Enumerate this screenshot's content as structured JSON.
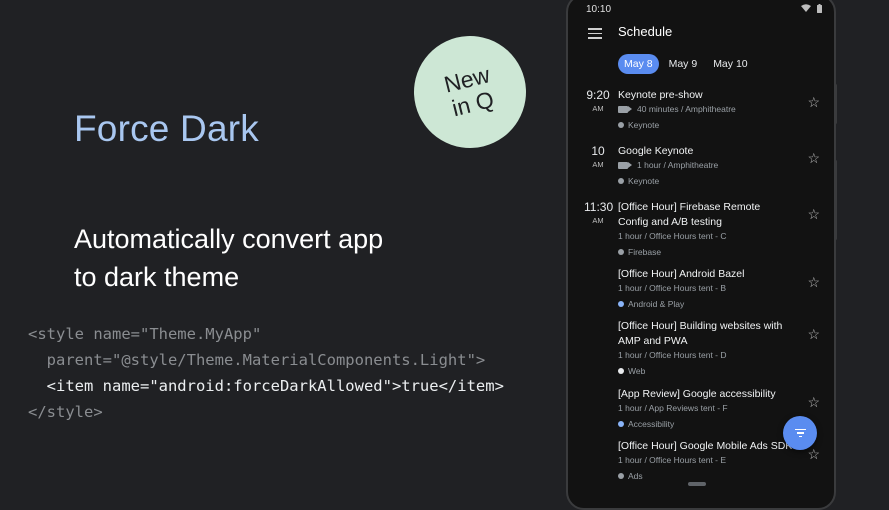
{
  "slide": {
    "title": "Force Dark",
    "subtitle_line1": "Automatically convert app",
    "subtitle_line2": "to dark theme",
    "badge_line1": "New",
    "badge_line2": "in Q",
    "code": {
      "line1": "<style name=\"Theme.MyApp\"",
      "line2": "  parent=\"@style/Theme.MaterialComponents.Light\">",
      "line3": "  <item name=\"android:forceDarkAllowed\">true</item>",
      "line4": "</style>"
    }
  },
  "phone": {
    "status_time": "10:10",
    "app_title": "Schedule",
    "day_tabs": [
      "May 8",
      "May 9",
      "May 10"
    ],
    "active_tab": "May 8",
    "slots": [
      {
        "time": "9:20",
        "ampm": "AM"
      },
      {
        "time": "10",
        "ampm": "AM"
      },
      {
        "time": "11:30",
        "ampm": "AM"
      }
    ],
    "sessions": [
      {
        "title": "Keynote pre-show",
        "meta": "40 minutes / Amphitheatre",
        "tag": "Keynote",
        "tag_color": "#9aa0a6"
      },
      {
        "title": "Google Keynote",
        "meta": "1 hour / Amphitheatre",
        "tag": "Keynote",
        "tag_color": "#9aa0a6"
      },
      {
        "title": "[Office Hour] Firebase Remote Config and A/B testing",
        "meta": "1 hour / Office Hours tent - C",
        "tag": "Firebase",
        "tag_color": "#9aa0a6"
      },
      {
        "title": "[Office Hour] Android Bazel",
        "meta": "1 hour / Office Hours tent - B",
        "tag": "Android & Play",
        "tag_color": "#8ab4f8"
      },
      {
        "title": "[Office Hour] Building websites with AMP and PWA",
        "meta": "1 hour / Office Hours tent - D",
        "tag": "Web",
        "tag_color": "#e8eaed"
      },
      {
        "title": "[App Review] Google accessibility",
        "meta": "1 hour / App Reviews tent - F",
        "tag": "Accessibility",
        "tag_color": "#8ab4f8"
      },
      {
        "title": "[Office Hour] Google Mobile Ads SDK",
        "meta": "1 hour / Office Hours tent - E",
        "tag": "Ads",
        "tag_color": "#9aa0a6"
      }
    ],
    "accent_color": "#5a8cf0"
  }
}
